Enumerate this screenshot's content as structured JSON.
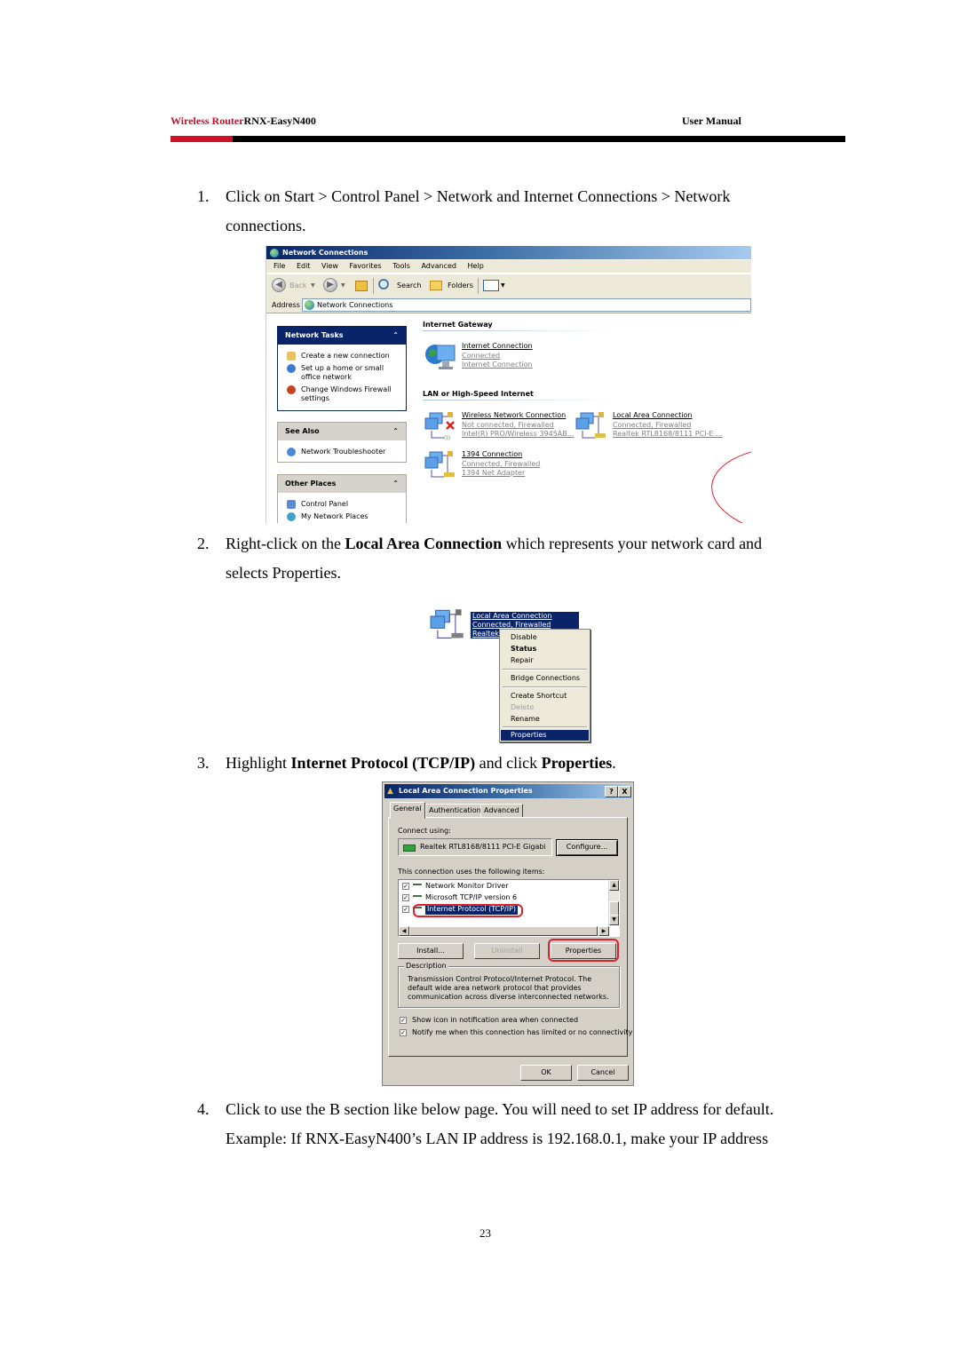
{
  "header": {
    "product_prefix": "Wireless Router",
    "product_model": "RNX-EasyN400",
    "manual_label": "User Manual",
    "accent_color": "#c8102e"
  },
  "steps": [
    {
      "num": "1.",
      "line1": "Click on Start > Control Panel > Network and Internet Connections > Network",
      "line2": "connections."
    },
    {
      "num": "2.",
      "line1_pre": "Right-click on the ",
      "line1_bold": "Local Area Connection",
      "line1_post": " which represents your network card and",
      "line2": "selects Properties."
    },
    {
      "num": "3.",
      "pre": "Highlight ",
      "bold1": "Internet Protocol",
      "mid": " ",
      "bold2": "(TCP/IP)",
      "mid2": " and click ",
      "bold3": "Properties",
      "post": "."
    },
    {
      "num": "4.",
      "line1": "Click to use the B section like below page. You will need to set IP address for default.",
      "line2": "Example: If RNX-EasyN400’s LAN IP address is 192.168.0.1, make your IP address"
    }
  ],
  "screenshot1": {
    "title": "Network Connections",
    "menu": [
      "File",
      "Edit",
      "View",
      "Favorites",
      "Tools",
      "Advanced",
      "Help"
    ],
    "toolbar": {
      "back": "Back",
      "search": "Search",
      "folders": "Folders"
    },
    "address_label": "Address",
    "address_value": "Network Connections",
    "task_panels": [
      {
        "title": "Network Tasks",
        "items": [
          "Create a new connection",
          "Set up a home or small office network",
          "Change Windows Firewall settings"
        ]
      },
      {
        "title": "See Also",
        "items": [
          "Network Troubleshooter"
        ]
      },
      {
        "title": "Other Places",
        "items": [
          "Control Panel",
          "My Network Places"
        ]
      }
    ],
    "groups": [
      {
        "title": "Internet Gateway"
      },
      {
        "title": "LAN or High-Speed Internet"
      }
    ],
    "connections": [
      {
        "name": "Internet Connection",
        "status": "Connected",
        "device": "Internet Connection"
      },
      {
        "name": "Wireless Network Connection",
        "status": "Not connected, Firewalled",
        "device": "Intel(R) PRO/Wireless 3945AB..."
      },
      {
        "name": "Local Area Connection",
        "status": "Connected, Firewalled",
        "device": "Realtek RTL8168/8111 PCI-E ..."
      },
      {
        "name": "1394 Connection",
        "status": "Connected, Firewalled",
        "device": "1394 Net Adapter"
      }
    ]
  },
  "screenshot2": {
    "selected_lines": [
      "Local Area Connection",
      "Connected, Firewalled",
      "Realtek"
    ],
    "context_menu": [
      "Disable",
      "Status",
      "Repair",
      "Bridge Connections",
      "Create Shortcut",
      "Delete",
      "Rename",
      "Properties"
    ]
  },
  "screenshot3": {
    "title": "Local Area Connection Properties",
    "title_buttons": [
      "?",
      "X"
    ],
    "tabs": [
      "General",
      "Authentication",
      "Advanced"
    ],
    "connect_using_label": "Connect using:",
    "adapter": "Realtek RTL8168/8111 PCI-E Gigabi",
    "configure_button": "Configure...",
    "items_label": "This connection uses the following items:",
    "items": [
      {
        "label": "Network Monitor Driver",
        "checked": true
      },
      {
        "label": "Microsoft TCP/IP version 6",
        "checked": true
      },
      {
        "label": "Internet Protocol (TCP/IP)",
        "checked": true,
        "selected": true
      }
    ],
    "install_button": "Install...",
    "uninstall_button": "Uninstall",
    "properties_button": "Properties",
    "description_label": "Description",
    "description_text": "Transmission Control Protocol/Internet Protocol. The default wide area network protocol that provides communication across diverse interconnected networks.",
    "checkbox_show_icon": "Show icon in notification area when connected",
    "checkbox_notify": "Notify me when this connection has limited or no connectivity",
    "ok_button": "OK",
    "cancel_button": "Cancel"
  },
  "page_number": "23"
}
